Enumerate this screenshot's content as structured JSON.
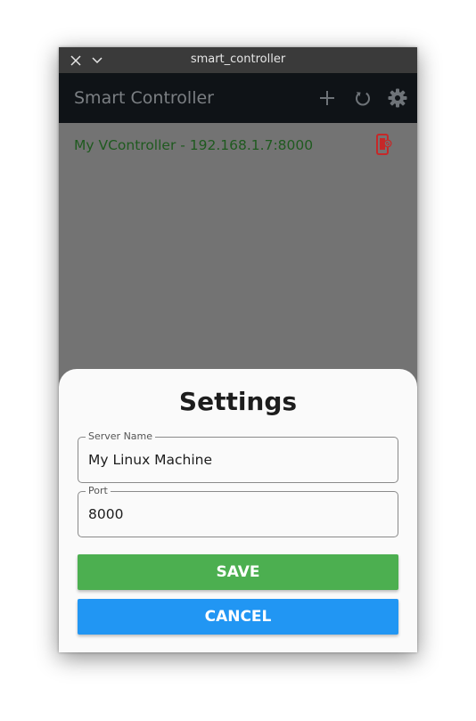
{
  "window": {
    "title": "smart_controller"
  },
  "appbar": {
    "title": "Smart Controller",
    "icons": [
      "add-icon",
      "refresh-icon",
      "settings-icon"
    ]
  },
  "servers": [
    {
      "label": "My VController - 192.168.1.7:8000",
      "status_icon": "device-disconnected-icon",
      "text_color": "#1f5a1f",
      "icon_color": "#c62828"
    }
  ],
  "settings_sheet": {
    "title": "Settings",
    "server_name": {
      "label": "Server Name",
      "value": "My Linux Machine"
    },
    "port": {
      "label": "Port",
      "value": "8000"
    },
    "save_label": "SAVE",
    "cancel_label": "CANCEL"
  },
  "colors": {
    "appbar": "#0f1317",
    "scrim": "#737373",
    "save": "#4caf50",
    "cancel": "#2196f3"
  }
}
